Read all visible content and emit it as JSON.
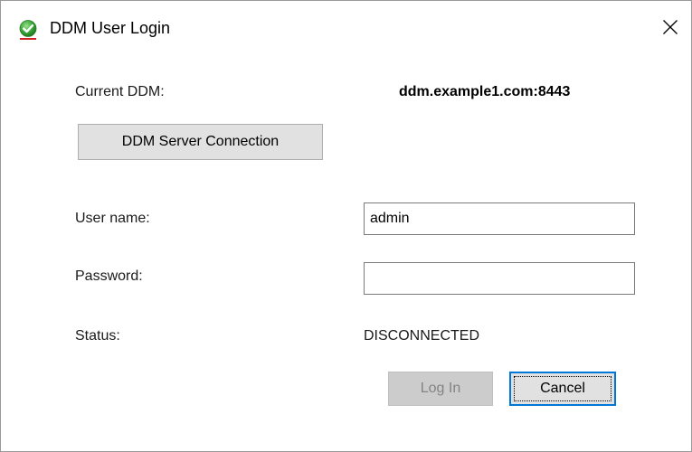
{
  "window": {
    "title": "DDM User Login",
    "close_symbol": "✕",
    "icon": "green-checkmark-icon"
  },
  "connection": {
    "current_label": "Current DDM:",
    "current_value": "ddm.example1.com:8443",
    "server_button_label": "DDM Server Connection"
  },
  "form": {
    "username_label": "User name:",
    "username_value": "admin",
    "password_label": "Password:",
    "password_value": ""
  },
  "status": {
    "label": "Status:",
    "value": "DISCONNECTED"
  },
  "actions": {
    "login_label": "Log In",
    "cancel_label": "Cancel"
  },
  "colors": {
    "accent": "#0078d7",
    "icon_green": "#3aa53a",
    "icon_red_underline": "#cc2222"
  }
}
